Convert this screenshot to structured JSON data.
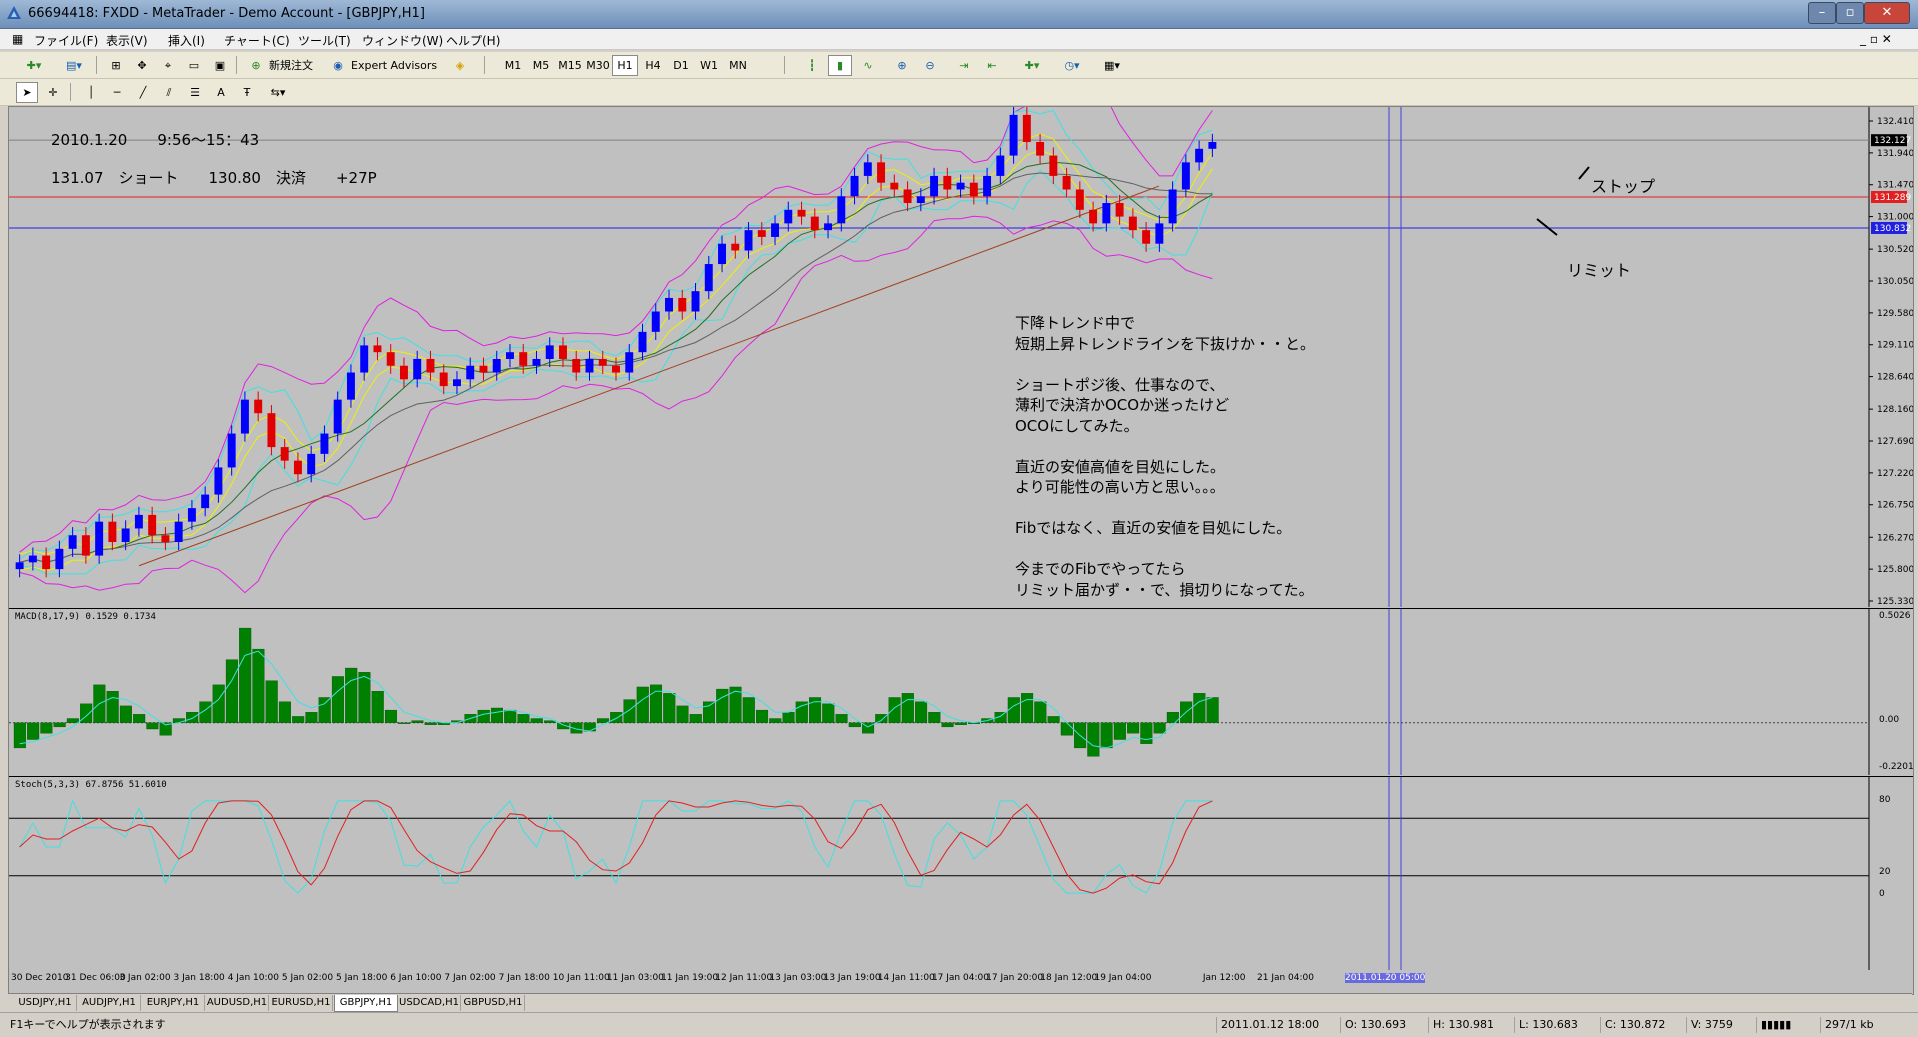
{
  "window": {
    "title": "66694418: FXDD - MetaTrader - Demo Account - [GBPJPY,H1]"
  },
  "menu": [
    "ファイル(F)",
    "表示(V)",
    "挿入(I)",
    "チャート(C)",
    "ツール(T)",
    "ウィンドウ(W)",
    "ヘルプ(H)"
  ],
  "toolbar": {
    "new_order": "新規注文",
    "expert_advisors": "Expert Advisors",
    "timeframes": [
      "M1",
      "M5",
      "M15",
      "M30",
      "H1",
      "H4",
      "D1",
      "W1",
      "MN"
    ],
    "active_timeframe": "H1"
  },
  "notes": {
    "header1": "2010.1.20　　9:56〜15：43",
    "header2": "131.07　ショート　　130.80　決済　　+27P",
    "body": "下降トレンド中で\n短期上昇トレンドラインを下抜けか・・と。\n\nショートポジ後、仕事なので、\n薄利で決済かOCOか迷ったけど\nOCOにしてみた。\n\n直近の安値高値を目処にした。\nより可能性の高い方と思い。。。\n\nFibではなく、直近の安値を目処にした。\n\n今までのFibでやってたら\nリミット届かず・・で、損切りになってた。",
    "stop": "ストップ",
    "limit": "リミット"
  },
  "chart_data": {
    "type": "candlestick",
    "symbol": "GBPJPY,H1",
    "price_ticks": [
      "132.410",
      "131.940",
      "131.470",
      "131.000",
      "130.520",
      "130.050",
      "129.580",
      "129.110",
      "128.640",
      "128.160",
      "127.690",
      "127.220",
      "126.750",
      "126.270",
      "125.800",
      "125.330"
    ],
    "price_range": [
      125.33,
      132.41
    ],
    "current_price_tag": "132.127",
    "stop_level": 131.289,
    "stop_tag": "131.289",
    "limit_level": 130.832,
    "limit_tag": "130.832",
    "candle_closes": [
      125.9,
      126.0,
      125.8,
      126.1,
      126.3,
      126.0,
      126.5,
      126.2,
      126.4,
      126.6,
      126.3,
      126.2,
      126.5,
      126.7,
      126.9,
      127.3,
      127.8,
      128.3,
      128.1,
      127.6,
      127.4,
      127.2,
      127.5,
      127.8,
      128.3,
      128.7,
      129.1,
      129.0,
      128.8,
      128.6,
      128.9,
      128.7,
      128.5,
      128.6,
      128.8,
      128.7,
      128.9,
      129.0,
      128.8,
      128.9,
      129.1,
      128.9,
      128.7,
      128.9,
      128.8,
      128.7,
      129.0,
      129.3,
      129.6,
      129.8,
      129.6,
      129.9,
      130.3,
      130.6,
      130.5,
      130.8,
      130.7,
      130.9,
      131.1,
      131.0,
      130.8,
      130.9,
      131.3,
      131.6,
      131.8,
      131.5,
      131.4,
      131.2,
      131.3,
      131.6,
      131.4,
      131.5,
      131.3,
      131.6,
      131.9,
      132.5,
      132.1,
      131.9,
      131.6,
      131.4,
      131.1,
      130.9,
      131.2,
      131.0,
      130.8,
      130.6,
      130.9,
      131.4,
      131.8,
      132.0,
      132.1
    ],
    "macd": {
      "label": "MACD(8,17,9) 0.1529 0.1734",
      "ticks": [
        "0.5026",
        "0.00",
        "-0.2201"
      ],
      "range": [
        -0.2201,
        0.5026
      ],
      "histogram": [
        -0.12,
        -0.08,
        -0.05,
        -0.02,
        0.02,
        0.09,
        0.18,
        0.15,
        0.08,
        0.04,
        -0.03,
        -0.06,
        0.02,
        0.05,
        0.1,
        0.18,
        0.3,
        0.45,
        0.35,
        0.2,
        0.1,
        0.03,
        0.05,
        0.12,
        0.22,
        0.26,
        0.24,
        0.15,
        0.06,
        0.0,
        0.01,
        -0.01,
        -0.01,
        0.01,
        0.04,
        0.06,
        0.07,
        0.06,
        0.04,
        0.02,
        0.01,
        -0.03,
        -0.05,
        -0.04,
        0.02,
        0.05,
        0.11,
        0.17,
        0.18,
        0.14,
        0.08,
        0.04,
        0.1,
        0.16,
        0.17,
        0.12,
        0.06,
        0.02,
        0.05,
        0.1,
        0.12,
        0.09,
        0.04,
        -0.02,
        -0.05,
        0.04,
        0.12,
        0.14,
        0.1,
        0.05,
        -0.02,
        -0.01,
        0.0,
        0.02,
        0.05,
        0.12,
        0.14,
        0.1,
        0.03,
        -0.06,
        -0.12,
        -0.16,
        -0.12,
        -0.08,
        -0.05,
        -0.1,
        -0.05,
        0.05,
        0.1,
        0.14,
        0.12
      ],
      "signal": [
        -0.1,
        -0.09,
        -0.07,
        -0.05,
        -0.02,
        0.03,
        0.09,
        0.12,
        0.11,
        0.08,
        0.03,
        -0.01,
        0.0,
        0.02,
        0.06,
        0.11,
        0.2,
        0.32,
        0.34,
        0.28,
        0.19,
        0.1,
        0.07,
        0.09,
        0.15,
        0.2,
        0.22,
        0.19,
        0.12,
        0.05,
        0.03,
        0.01,
        0.0,
        0.0,
        0.02,
        0.04,
        0.05,
        0.06,
        0.05,
        0.03,
        0.02,
        -0.01,
        -0.03,
        -0.04,
        -0.01,
        0.02,
        0.06,
        0.11,
        0.15,
        0.15,
        0.11,
        0.07,
        0.08,
        0.12,
        0.15,
        0.14,
        0.1,
        0.05,
        0.05,
        0.08,
        0.1,
        0.1,
        0.07,
        0.02,
        -0.02,
        0.01,
        0.07,
        0.11,
        0.11,
        0.08,
        0.03,
        0.01,
        0.0,
        0.01,
        0.03,
        0.08,
        0.11,
        0.11,
        0.07,
        0.0,
        -0.06,
        -0.11,
        -0.12,
        -0.1,
        -0.07,
        -0.08,
        -0.07,
        -0.01,
        0.05,
        0.1,
        0.12
      ]
    },
    "stoch": {
      "label": "Stoch(5,3,3) 67.8756 51.6010",
      "levels": [
        80,
        20
      ],
      "ticks": [
        "80",
        "20",
        "0"
      ],
      "range": [
        0,
        100
      ]
    },
    "x_ticks": [
      "30 Dec 2010",
      "31 Dec 06:00",
      "3 Jan 02:00",
      "3 Jan 18:00",
      "4 Jan 10:00",
      "5 Jan 02:00",
      "5 Jan 18:00",
      "6 Jan 10:00",
      "7 Jan 02:00",
      "7 Jan 18:00",
      "10 Jan 11:00",
      "11 Jan 03:00",
      "11 Jan 19:00",
      "12 Jan 11:00",
      "13 Jan 03:00",
      "13 Jan 19:00",
      "14 Jan 11:00",
      "17 Jan 04:00",
      "17 Jan 20:00",
      "18 Jan 12:00",
      "19 Jan 04:00",
      "2011.01.20 05:00",
      "Jan 12:00",
      "21 Jan 04:00"
    ],
    "x_cursor_label": "2011.01.20 05:00"
  },
  "tabs": [
    "USDJPY,H1",
    "AUDJPY,H1",
    "EURJPY,H1",
    "AUDUSD,H1",
    "EURUSD,H1",
    "GBPJPY,H1",
    "USDCAD,H1",
    "GBPUSD,H1"
  ],
  "active_tab": "GBPJPY,H1",
  "status": {
    "help": "F1キーでヘルプが表示されます",
    "datetime": "2011.01.12 18:00",
    "open": "O: 130.693",
    "high": "H: 130.981",
    "low": "L: 130.683",
    "close": "C: 130.872",
    "volume": "V: 3759",
    "traffic": "297/1 kb"
  }
}
